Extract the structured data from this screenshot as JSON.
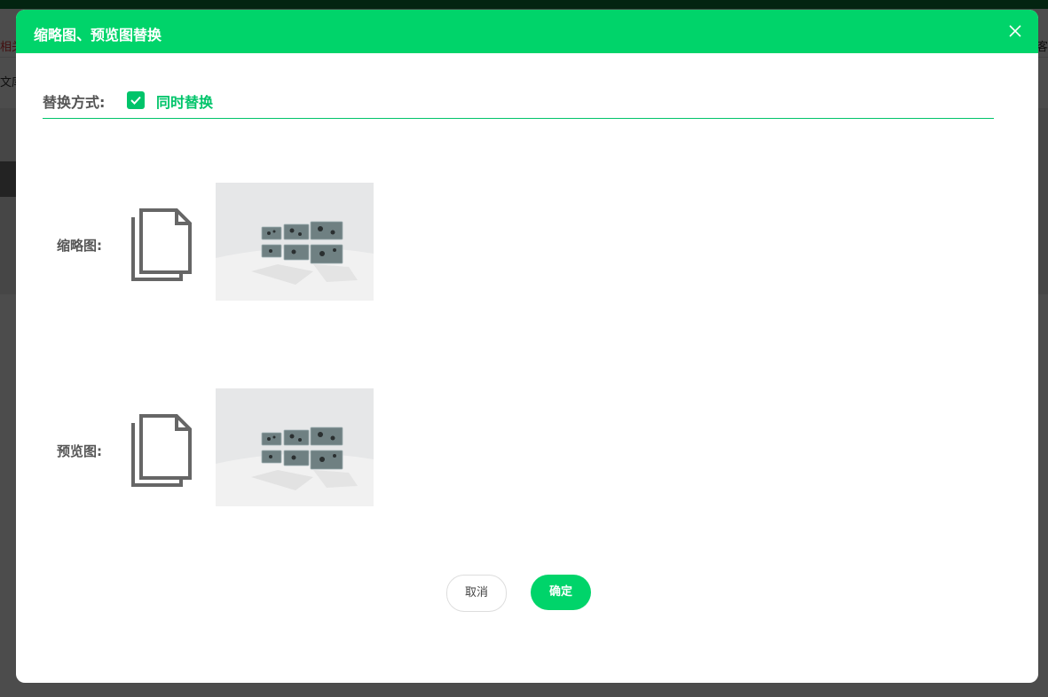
{
  "background": {
    "row1_left": "相关",
    "row1_right": "客",
    "row2_left": "文库"
  },
  "dialog": {
    "title": "缩略图、预览图替换",
    "close_icon": "close-icon",
    "mode_label": "替换方式:",
    "mode_checkbox_checked": true,
    "mode_checkbox_label": "同时替换",
    "thumbnail": {
      "label": "缩略图:",
      "upload_icon": "document-copy-icon"
    },
    "preview": {
      "label": "预览图:",
      "upload_icon": "document-copy-icon"
    },
    "cancel_label": "取消",
    "ok_label": "确定"
  },
  "colors": {
    "accent": "#00d46a",
    "text": "#555555"
  }
}
